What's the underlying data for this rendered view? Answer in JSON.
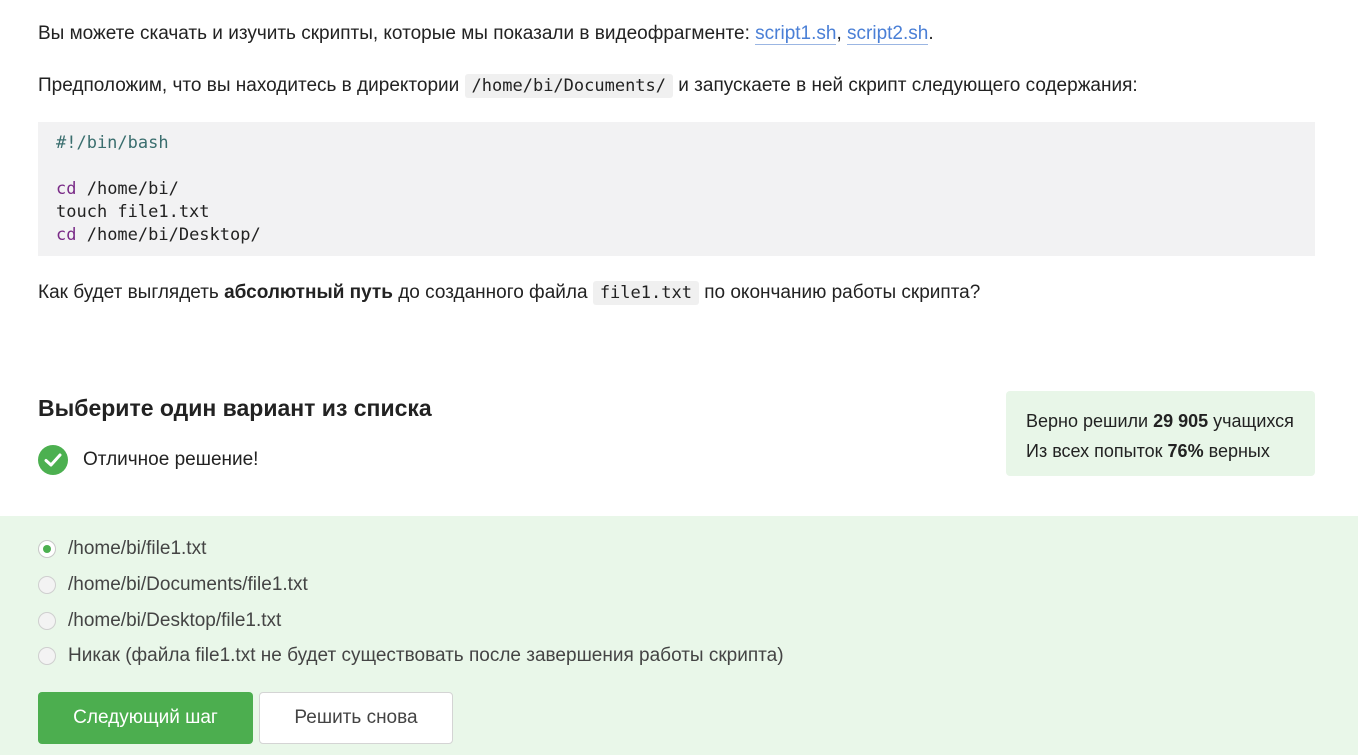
{
  "intro": {
    "text": "Вы можете скачать и изучить скрипты, которые мы показали в видеофрагменте: ",
    "link1": "script1.sh",
    "sep": ", ",
    "link2": "script2.sh",
    "end": "."
  },
  "context": {
    "before": "Предположим, что вы находитесь в директории ",
    "dir": "/home/bi/Documents/",
    "after": " и запускаете в ней скрипт следующего содержания:"
  },
  "code": {
    "shebang": "#!/bin/bash",
    "l3_kw": "cd",
    "l3_arg": " /home/bi/",
    "l4": "touch file1.txt",
    "l5_kw": "cd",
    "l5_arg": " /home/bi/Desktop/"
  },
  "question": {
    "before": "Как будет выглядеть ",
    "bold": "абсолютный путь",
    "middle": " до созданного файла ",
    "file": "file1.txt",
    "after": " по окончанию работы скрипта?"
  },
  "section_title": "Выберите один вариант из списка",
  "feedback": "Отличное решение!",
  "stats": {
    "line1_prefix": "Верно решили ",
    "line1_count": "29 905",
    "line1_suffix": " учащихся",
    "line2_prefix": "Из всех попыток ",
    "line2_percent": "76%",
    "line2_suffix": " верных"
  },
  "options": [
    {
      "label": "/home/bi/file1.txt",
      "selected": true
    },
    {
      "label": "/home/bi/Documents/file1.txt",
      "selected": false
    },
    {
      "label": "/home/bi/Desktop/file1.txt",
      "selected": false
    },
    {
      "label": "Никак (файла file1.txt не будет существовать после завершения работы скрипта)",
      "selected": false
    }
  ],
  "buttons": {
    "next": "Следующий шаг",
    "retry": "Решить снова"
  },
  "colors": {
    "accent_green": "#4cae4f",
    "link_blue": "#4a7fd6",
    "answer_bg": "#e9f7e9"
  }
}
